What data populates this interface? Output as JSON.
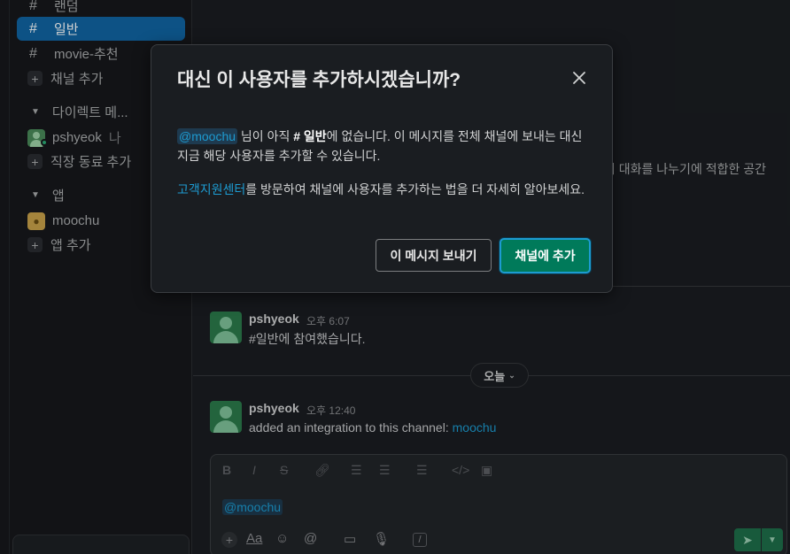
{
  "sidebar": {
    "channels": [
      {
        "hash": "#",
        "label": "랜덤"
      },
      {
        "hash": "#",
        "label": "일반",
        "active": true
      },
      {
        "hash": "#",
        "label": "movie-추천"
      }
    ],
    "add_channel": "채널 추가",
    "dm_section": "다이렉트 메...",
    "dm_user": "pshyeok",
    "dm_self": "나",
    "add_colleague": "직장 동료 추가",
    "apps_section": "앱",
    "app_item": "moochu",
    "add_app": "앱 추가"
  },
  "main": {
    "bg_description": "의 대화를 나누기에 적합한 공간",
    "messages": [
      {
        "author": "pshyeok",
        "time": "오후 6:07",
        "text": "#일반에 참여했습니다."
      },
      {
        "author": "pshyeok",
        "time": "오후 12:40",
        "text": "added an integration to this channel: ",
        "link": "moochu"
      }
    ],
    "day_label": "오늘",
    "composer": {
      "format_icons": [
        "B",
        "I",
        "S"
      ],
      "text": "@moochu",
      "aa": "Aa"
    }
  },
  "modal": {
    "title": "대신 이 사용자를 추가하시겠습니까?",
    "para1_mention": "@moochu",
    "para1_a": " 님이 아직 ",
    "para1_channel": "# 일반",
    "para1_b": "에 없습니다. 이 메시지를 전체 채널에 보내는 대신 지금 해당 사용자를 추가할 수 있습니다.",
    "para2_link": "고객지원센터",
    "para2_text": "를 방문하여 채널에 사용자를 추가하는 법을 더 자세히 알아보세요.",
    "secondary_button": "이 메시지 보내기",
    "primary_button": "채널에 추가"
  }
}
